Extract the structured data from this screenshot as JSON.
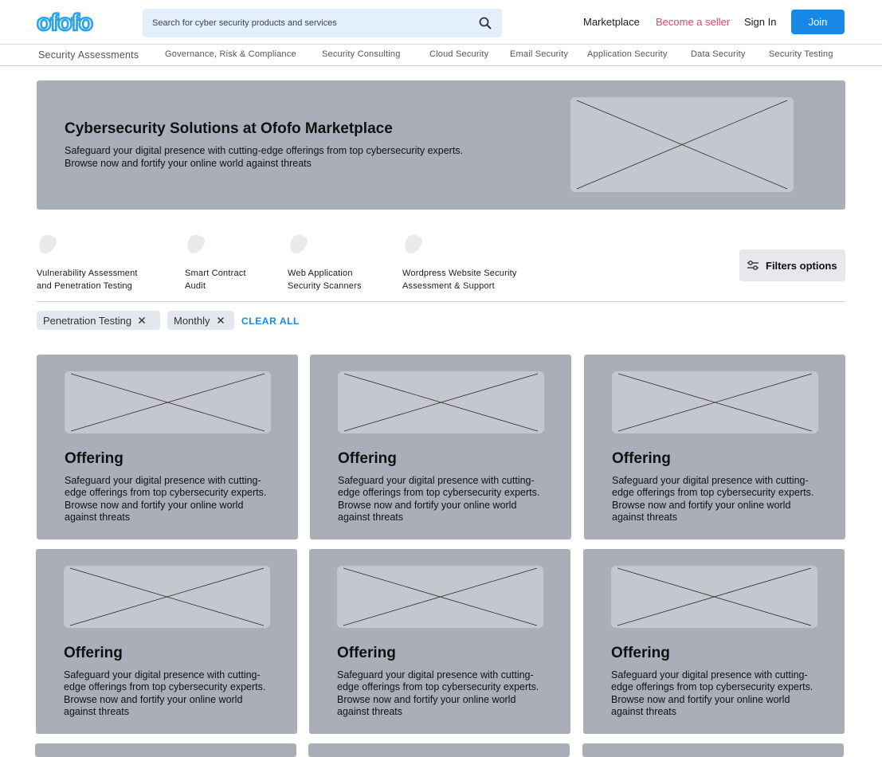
{
  "header": {
    "logo_text": "ofofo",
    "search_placeholder": "Search for cyber security products and services",
    "nav": {
      "marketplace": "Marketplace",
      "become_seller": "Become a seller",
      "sign_in": "Sign In",
      "join": "Join"
    },
    "colors": {
      "brand": "#2aa3e8",
      "join_bg": "#1788e6",
      "seller": "#e2426b"
    }
  },
  "categories": [
    "Security Assessments",
    "Governance, Risk & Compliance",
    "Security Consulting",
    "Cloud Security",
    "Email Security",
    "Application Security",
    "Data Security",
    "Security Testing"
  ],
  "hero": {
    "title": "Cybersecurity Solutions at Ofofo Marketplace",
    "text": "Safeguard your digital presence with cutting-edge offerings from top cybersecurity experts. Browse now and fortify your online world against threats"
  },
  "quick_categories": [
    {
      "line1": "Vulnerability Assessment",
      "line2": "and Penetration Testing",
      "icon": "shield-icon"
    },
    {
      "line1": "Smart Contract",
      "line2": "Audit",
      "icon": "shield-icon"
    },
    {
      "line1": "Web Application",
      "line2": "Security Scanners",
      "icon": "shield-icon"
    },
    {
      "line1": "Wordpress Website Security",
      "line2": "Assessment & Support",
      "icon": "shield-icon"
    }
  ],
  "filters_button": "Filters options",
  "active_filters": [
    "Penetration Testing",
    "Monthly"
  ],
  "clear_all": "CLEAR ALL",
  "offerings": [
    {
      "title": "Offering",
      "text": "Safeguard your digital presence with cutting-edge offerings from top cybersecurity experts. Browse now and fortify your online world against threats"
    },
    {
      "title": "Offering",
      "text": "Safeguard your digital presence with cutting-edge offerings from top cybersecurity experts. Browse now and fortify your online world against threats"
    },
    {
      "title": "Offering",
      "text": "Safeguard your digital presence with cutting-edge offerings from top cybersecurity experts. Browse now and fortify your online world against threats"
    },
    {
      "title": "Offering",
      "text": "Safeguard your digital presence with cutting-edge offerings from top cybersecurity experts. Browse now and fortify your online world against threats"
    },
    {
      "title": "Offering",
      "text": "Safeguard your digital presence with cutting-edge offerings from top cybersecurity experts. Browse now and fortify your online world against threats"
    },
    {
      "title": "Offering",
      "text": "Safeguard your digital presence with cutting-edge offerings from top cybersecurity experts. Browse now and fortify your online world against threats"
    }
  ]
}
